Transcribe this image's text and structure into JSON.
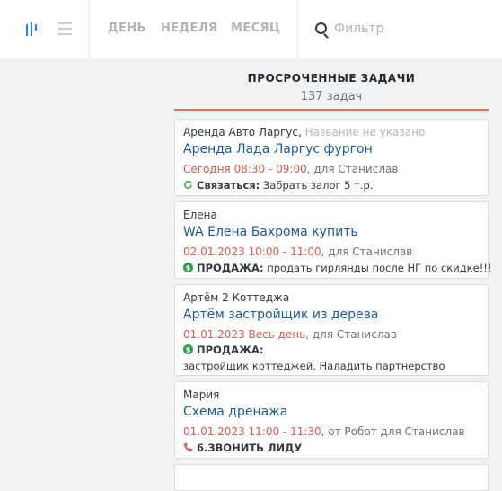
{
  "toolbar": {
    "periods": [
      "ДЕНЬ",
      "НЕДЕЛЯ",
      "МЕСЯЦ"
    ],
    "search_placeholder": "Фильтр"
  },
  "column": {
    "title": "ПРОСРОЧЕННЫЕ ЗАДАЧИ",
    "count": "137 задач"
  },
  "cards": [
    {
      "contact": "Аренда Авто Ларгус,",
      "contact_extra": "Название не указано",
      "title": "Аренда Лада Ларгус фургон",
      "date": "Сегодня 08:30 - 09:00",
      "owner": ", для Станислав",
      "type_icon": "refresh-icon",
      "action_label": "Связаться:",
      "action_text": " Забрать залог 5 т.р."
    },
    {
      "contact": "Елена",
      "title": "WA Елена Бахрома купить",
      "date": "02.01.2023 10:00 - 11:00",
      "owner": ", для Станислав",
      "type_icon": "dollar-icon",
      "action_label": "ПРОДАЖА:",
      "action_text": " продать гирлянды после НГ по скидке!!!"
    },
    {
      "contact": "Артём 2 Коттеджа",
      "title": "Артём застройщик из дерева",
      "date": "01.01.2023 Весь день",
      "owner": ", для Станислав",
      "type_icon": "dollar-icon",
      "action_label": "ПРОДАЖА:",
      "note": "застройщик коттеджей. Наладить партнерство"
    },
    {
      "contact": "Мария",
      "title": "Схема дренажа",
      "date": "01.01.2023 11:00 - 11:30",
      "owner": ", от Робот для Станислав",
      "type_icon": "phone-icon",
      "action_label": "6.ЗВОНИТЬ ЛИДУ"
    }
  ],
  "colors": {
    "accent": "#1e88e5",
    "overdue": "#e4584b",
    "link": "#1a5a9c",
    "column_border": "#e86a5d"
  }
}
